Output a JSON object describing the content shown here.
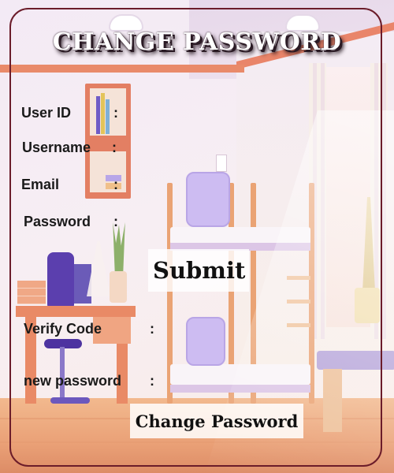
{
  "form": {
    "title": "CHANGE PASSWORD",
    "fields": {
      "user_id": {
        "label": "User ID",
        "value": ""
      },
      "username": {
        "label": "Username",
        "value": ""
      },
      "email": {
        "label": "Email",
        "value": ""
      },
      "password": {
        "label": "Password",
        "value": ""
      },
      "verify_code": {
        "label": "Verify Code",
        "value": ""
      },
      "new_password": {
        "label": "new password",
        "value": ""
      }
    },
    "colon": ":",
    "submit_label": "Submit",
    "change_password_label": "Change Password"
  },
  "colors": {
    "frame_border": "#6b1c2a",
    "title_text": "#ffffff",
    "title_shadow": "#2a1a24",
    "button_background": "#ffffff",
    "label_text": "#1a1a1a"
  }
}
